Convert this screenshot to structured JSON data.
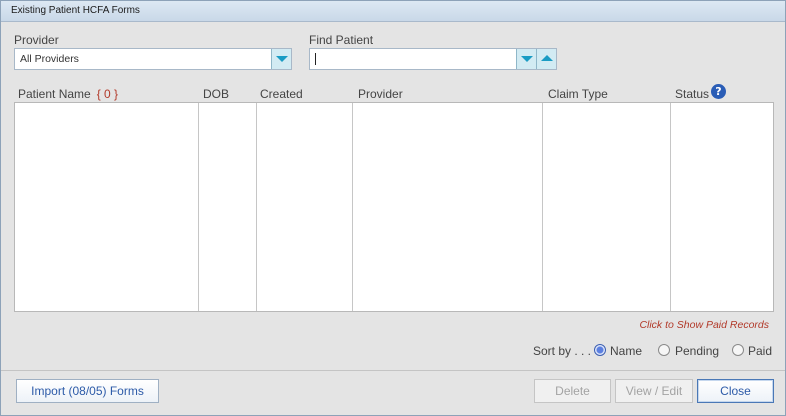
{
  "window": {
    "title": "Existing Patient HCFA Forms"
  },
  "provider": {
    "label": "Provider",
    "value": "All Providers"
  },
  "find_patient": {
    "label": "Find Patient",
    "value": ""
  },
  "table": {
    "columns": {
      "patient_name": "Patient Name",
      "patient_count": "{ 0 }",
      "dob": "DOB",
      "created": "Created",
      "provider": "Provider",
      "claim_type": "Claim Type",
      "status": "Status"
    },
    "help_glyph": "?",
    "rows": []
  },
  "show_paid_link": "Click to Show Paid Records",
  "sort": {
    "label": "Sort by . . .",
    "options": [
      "Name",
      "Pending",
      "Paid"
    ],
    "selected": "Name"
  },
  "buttons": {
    "import": "Import (08/05) Forms",
    "delete": "Delete",
    "view_edit": "View / Edit",
    "close": "Close"
  },
  "colors": {
    "accent": "#1a9cc4",
    "link": "#b23a2a",
    "radio_selected": "#5b7fe0"
  }
}
